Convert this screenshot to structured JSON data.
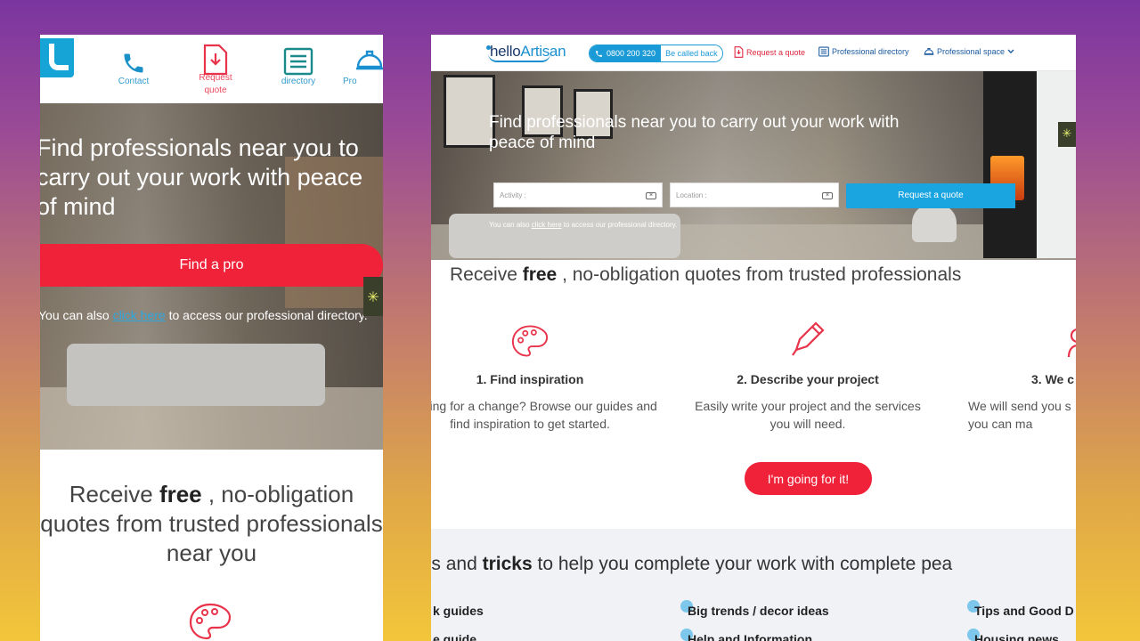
{
  "mobile": {
    "nav": {
      "items": [
        {
          "label": "Contact",
          "icon": "phone-icon"
        },
        {
          "label": "Request\nquote",
          "icon": "document-download-icon"
        },
        {
          "label": "directory",
          "icon": "list-icon"
        },
        {
          "label": "Pro",
          "icon": "helmet-icon"
        }
      ]
    },
    "hero": {
      "title": "Find professionals near you to carry out your work with peace of mind",
      "cta": "Find a pro",
      "also_prefix": "You can also ",
      "also_link": "click here",
      "also_suffix": " to access our professional directory."
    },
    "receive": {
      "pre": "Receive ",
      "bold": "free",
      "post": " , no-obligation quotes from trusted professionals near you"
    }
  },
  "desktop": {
    "nav": {
      "logo_hello": "hello",
      "logo_artisan": "Artisan",
      "phone": "0800 200 320",
      "call_back": "Be called back",
      "request_quote": "Request a quote",
      "directory": "Professional directory",
      "pro_space": "Professional space"
    },
    "hero": {
      "title": "Find professionals near you to carry out your work with peace of mind",
      "activity_placeholder": "Activity :",
      "location_placeholder": "Location :",
      "request_button": "Request a quote",
      "also_prefix": "You can also ",
      "also_link": "click here",
      "also_suffix": " to access our professional directory."
    },
    "receive": {
      "pre": "Receive ",
      "bold": "free",
      "post": " , no-obligation quotes from trusted professionals"
    },
    "steps": [
      {
        "title": "1. Find inspiration",
        "desc": "Looking for a change? Browse our guides and find inspiration to get started.",
        "icon": "palette-icon"
      },
      {
        "title": "2. Describe your project",
        "desc": "Easily write your project and the services you will need.",
        "icon": "pen-icon"
      },
      {
        "title": "3. We c",
        "desc": "We will send you s you can ma",
        "icon": "person-icon"
      }
    ],
    "cta": "I'm going for it!",
    "tips": {
      "pre": "Tips and ",
      "bold": "tricks",
      "post": " to help you complete your work with complete pea",
      "items": [
        "k guides",
        "Big trends / decor ideas",
        "Tips and Good D",
        "e guide",
        "Help and Information",
        "Housing news"
      ]
    }
  },
  "colors": {
    "brand_blue": "#1aa4e0",
    "brand_red": "#f0223a",
    "navy": "#1b3a6b"
  }
}
